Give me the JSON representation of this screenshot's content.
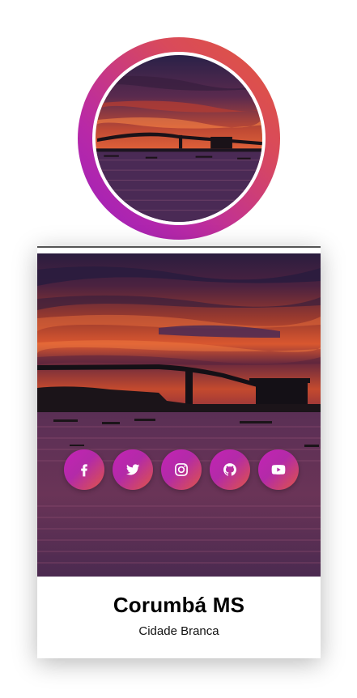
{
  "profile": {
    "title": "Corumbá MS",
    "subtitle": "Cidade Branca"
  },
  "avatar": {
    "image": "sunset-river-bridge-photo",
    "ring_colors": [
      "#e0573a",
      "#9a1fc0"
    ]
  },
  "cover": {
    "image": "sunset-river-bridge-photo"
  },
  "socials": [
    {
      "name": "facebook",
      "icon": "facebook-icon"
    },
    {
      "name": "twitter",
      "icon": "twitter-icon"
    },
    {
      "name": "instagram",
      "icon": "instagram-icon"
    },
    {
      "name": "github",
      "icon": "github-icon"
    },
    {
      "name": "youtube",
      "icon": "youtube-icon"
    }
  ],
  "colors": {
    "button_gradient_start": "#c423b5",
    "button_gradient_end": "#e05545"
  }
}
